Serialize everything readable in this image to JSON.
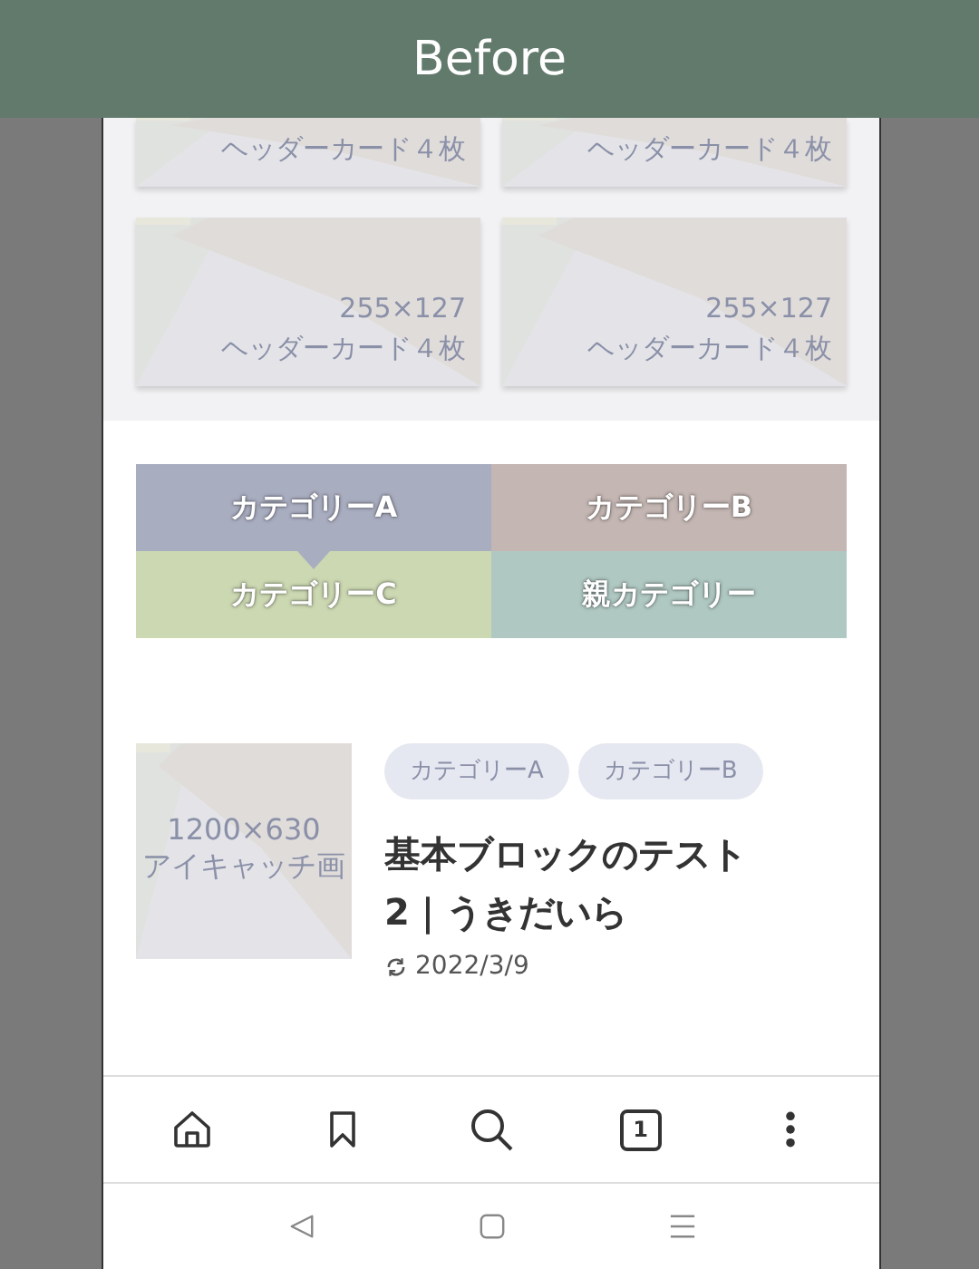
{
  "header": {
    "title": "Before"
  },
  "header_cards": [
    {
      "label": "ヘッダーカード４枚"
    },
    {
      "label": "ヘッダーカード４枚"
    },
    {
      "size": "255×127",
      "label": "ヘッダーカード４枚"
    },
    {
      "size": "255×127",
      "label": "ヘッダーカード４枚"
    }
  ],
  "categories": [
    {
      "label": "カテゴリーA",
      "selected": true,
      "color": "#a9adc0"
    },
    {
      "label": "カテゴリーB",
      "selected": false,
      "color": "#c4b6b2"
    },
    {
      "label": "カテゴリーC",
      "selected": false,
      "color": "#ccd8b2"
    },
    {
      "label": "親カテゴリー",
      "selected": false,
      "color": "#b0c8c2"
    }
  ],
  "post": {
    "thumbnail": {
      "size": "1200×630",
      "label": "アイキャッチ画"
    },
    "tags": [
      "カテゴリーA",
      "カテゴリーB"
    ],
    "title": "基本ブロックのテスト2｜うきだいら",
    "date": "2022/3/9"
  },
  "bottom_nav": [
    {
      "kind": "home"
    },
    {
      "kind": "bookmark"
    },
    {
      "kind": "search"
    },
    {
      "kind": "tabs",
      "count": "1"
    },
    {
      "kind": "more"
    }
  ],
  "system_nav": [
    {
      "kind": "back"
    },
    {
      "kind": "home"
    },
    {
      "kind": "recents"
    }
  ]
}
